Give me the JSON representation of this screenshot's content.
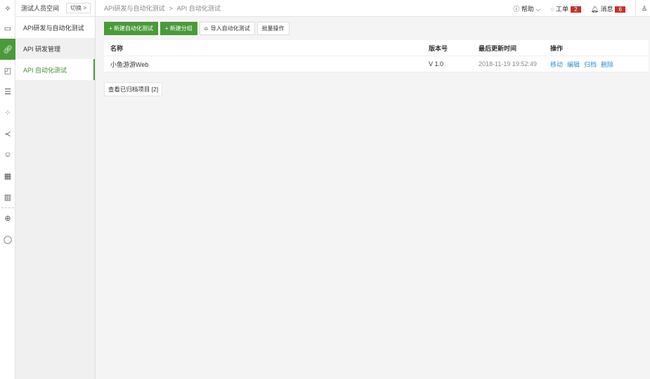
{
  "workspace": {
    "name": "测试人员空间",
    "switch_label": "切换 >"
  },
  "breadcrumb": [
    "API研发与自动化测试",
    ">",
    "API 自动化测试"
  ],
  "header": {
    "help": "帮助",
    "tickets": "工单",
    "tickets_count": "2",
    "messages": "消息",
    "messages_count": "6"
  },
  "sidebar": {
    "items": [
      "API研发与自动化测试",
      "API 研发管理",
      "API 自动化测试"
    ]
  },
  "toolbar": {
    "new_test": "+ 新建自动化测试",
    "new_group": "+ 新建分组",
    "import": "导入自动化测试",
    "batch": "批量操作"
  },
  "table": {
    "headers": [
      "名称",
      "版本号",
      "最后更新时间",
      "操作"
    ],
    "rows": [
      {
        "name": "小鱼游游Web",
        "version": "V 1.0",
        "updated": "2018-11-19 19:52:49",
        "actions": [
          "移动",
          "编辑",
          "归档",
          "删除"
        ]
      }
    ]
  },
  "archived_button": "查看已归档项目 [2]",
  "colors": {
    "accent": "#4a9a3a",
    "link": "#3a8fd0",
    "badge": "#c9302c"
  }
}
